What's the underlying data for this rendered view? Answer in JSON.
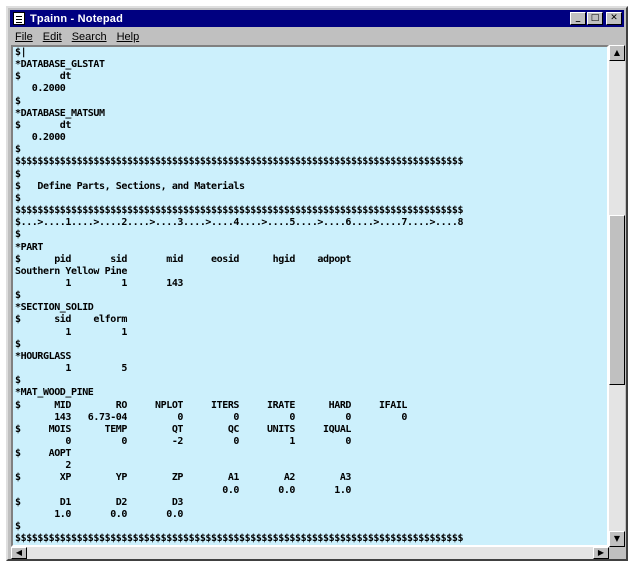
{
  "window": {
    "title": "Tpainn - Notepad",
    "buttons": {
      "minimize": "_",
      "maximize": "□",
      "close": "✕"
    }
  },
  "menu": [
    {
      "label": "File"
    },
    {
      "label": "Edit"
    },
    {
      "label": "Search"
    },
    {
      "label": "Help"
    }
  ],
  "editor": {
    "content": "$|\n*DATABASE_GLSTAT\n$       dt\n   0.2000\n$\n*DATABASE_MATSUM\n$       dt\n   0.2000\n$\n$$$$$$$$$$$$$$$$$$$$$$$$$$$$$$$$$$$$$$$$$$$$$$$$$$$$$$$$$$$$$$$$$$$$$$$$$$$$$$$$\n$\n$   Define Parts, Sections, and Materials\n$\n$$$$$$$$$$$$$$$$$$$$$$$$$$$$$$$$$$$$$$$$$$$$$$$$$$$$$$$$$$$$$$$$$$$$$$$$$$$$$$$$\n$...>....1....>....2....>....3....>....4....>....5....>....6....>....7....>....8\n$\n*PART\n$      pid       sid       mid     eosid      hgid    adpopt\nSouthern Yellow Pine\n         1         1       143\n$\n*SECTION_SOLID\n$      sid    elform\n         1         1\n$\n*HOURGLASS\n         1         5\n$\n*MAT_WOOD_PINE\n$      MID        RO     NPLOT     ITERS     IRATE      HARD     IFAIL\n       143   6.73-04         0         0         0         0         0\n$     MOIS      TEMP        QT        QC     UNITS     IQUAL\n         0         0        -2         0         1         0\n$     AOPT\n         2\n$       XP        YP        ZP        A1        A2        A3\n                                     0.0       0.0       1.0\n$       D1        D2        D3\n       1.0       0.0       0.0\n$\n$$$$$$$$$$$$$$$$$$$$$$$$$$$$$$$$$$$$$$$$$$$$$$$$$$$$$$$$$$$$$$$$$$$$$$$$$$$$$$$$"
  },
  "scroll_arrows": {
    "up": "▲",
    "down": "▼",
    "left": "◀",
    "right": "▶"
  },
  "colors": {
    "titlebar": "#000080",
    "editor_bg": "#ccf0fc",
    "chrome": "#c0c0c0"
  }
}
